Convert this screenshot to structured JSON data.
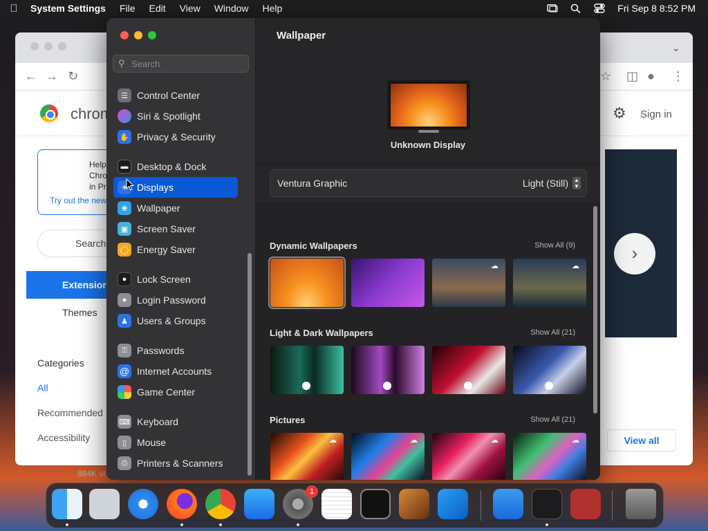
{
  "menubar": {
    "app_name": "System Settings",
    "menus": [
      "File",
      "Edit",
      "View",
      "Window",
      "Help"
    ],
    "clock": "Fri Sep 8  8:52 PM"
  },
  "chrome_bg": {
    "title": "chrom",
    "sign_in": "Sign in",
    "promo_heading": "Help\nChro\nin Pr",
    "promo_link": "Try out the new",
    "search_label": "Search",
    "extensions_label": "Extension",
    "themes_label": "Themes",
    "categories_label": "Categories",
    "categories": [
      "All",
      "Recommended",
      "Accessibility"
    ],
    "view_all": "View all",
    "download_text": "884K vi"
  },
  "settings": {
    "search_placeholder": "Search",
    "sidebar_items": [
      {
        "label": "Control Center",
        "icon": "control-center-icon",
        "color": "#6e6e73"
      },
      {
        "label": "Siri & Spotlight",
        "icon": "siri-icon",
        "color": "#b445d8"
      },
      {
        "label": "Privacy & Security",
        "icon": "hand-icon",
        "color": "#2c72e6"
      },
      {
        "label": "Desktop & Dock",
        "icon": "dock-icon",
        "color": "#2a2a2c"
      },
      {
        "label": "Displays",
        "icon": "displays-icon",
        "color": "#2c72e6"
      },
      {
        "label": "Wallpaper",
        "icon": "wallpaper-icon",
        "color": "#30a4e6"
      },
      {
        "label": "Screen Saver",
        "icon": "screen-saver-icon",
        "color": "#45b5d9"
      },
      {
        "label": "Energy Saver",
        "icon": "energy-icon",
        "color": "#f5a623"
      },
      {
        "label": "Lock Screen",
        "icon": "lock-icon",
        "color": "#1c1c1e"
      },
      {
        "label": "Login Password",
        "icon": "login-password-icon",
        "color": "#8e8e93"
      },
      {
        "label": "Users & Groups",
        "icon": "users-icon",
        "color": "#2c72e6"
      },
      {
        "label": "Passwords",
        "icon": "key-icon",
        "color": "#8e8e93"
      },
      {
        "label": "Internet Accounts",
        "icon": "at-icon",
        "color": "#2c72e6"
      },
      {
        "label": "Game Center",
        "icon": "game-center-icon",
        "color": "#e8e8e8"
      },
      {
        "label": "Keyboard",
        "icon": "keyboard-icon",
        "color": "#8e8e93"
      },
      {
        "label": "Mouse",
        "icon": "mouse-icon",
        "color": "#8e8e93"
      },
      {
        "label": "Printers & Scanners",
        "icon": "printer-icon",
        "color": "#8e8e93"
      }
    ],
    "selected_item": "Displays",
    "main_title": "Wallpaper",
    "display_name": "Unknown Display",
    "wallpaper_name": "Ventura Graphic",
    "wallpaper_mode": "Light (Still)",
    "sections": [
      {
        "title": "Dynamic Wallpapers",
        "show_all": "Show All (9)"
      },
      {
        "title": "Light & Dark Wallpapers",
        "show_all": "Show All (21)"
      },
      {
        "title": "Pictures",
        "show_all": "Show All (21)"
      }
    ]
  },
  "dock": {
    "apps": [
      "Finder",
      "Launchpad",
      "Safari",
      "Firefox",
      "Chrome",
      "App Store",
      "System Settings",
      "TextEdit",
      "Terminal",
      "GarageBand",
      "VS Code",
      "Keynote",
      "Activity Monitor",
      "Dictionary",
      "Trash"
    ],
    "settings_badge": "1"
  }
}
